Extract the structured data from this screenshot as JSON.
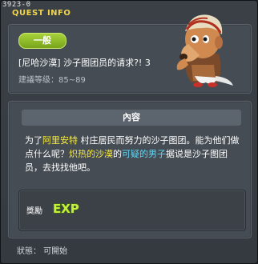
{
  "window": {
    "id_label": "3923-0",
    "title": "QUEST INFO"
  },
  "quest": {
    "category_badge": "一般",
    "name": "[尼哈沙漠] 沙子图团员的请求?! 3",
    "level_requirement": "建議等级：85~89"
  },
  "content": {
    "header": "內容",
    "segments": [
      {
        "text": "为了",
        "hl": ""
      },
      {
        "text": "阿里安特",
        "hl": "yellow"
      },
      {
        "text": " 村庄居民而努力的沙子图团。能为他们做点什么呢？",
        "hl": ""
      },
      {
        "text": "炽热的沙漠",
        "hl": "yellow"
      },
      {
        "text": "的",
        "hl": ""
      },
      {
        "text": "可疑的男子",
        "hl": "cyan"
      },
      {
        "text": "据说是沙子图团员，去找找他吧。",
        "hl": ""
      }
    ]
  },
  "reward": {
    "label": "獎勵",
    "exp_text": "EXP"
  },
  "status": {
    "text": "狀態： 可開始"
  },
  "colors": {
    "title": "#f0d44a",
    "badge": "#8cbc28",
    "highlight_yellow": "#f7ea3e",
    "highlight_cyan": "#5fd8f6"
  },
  "icons": [
    "npc-portrait",
    "exp-icon"
  ]
}
